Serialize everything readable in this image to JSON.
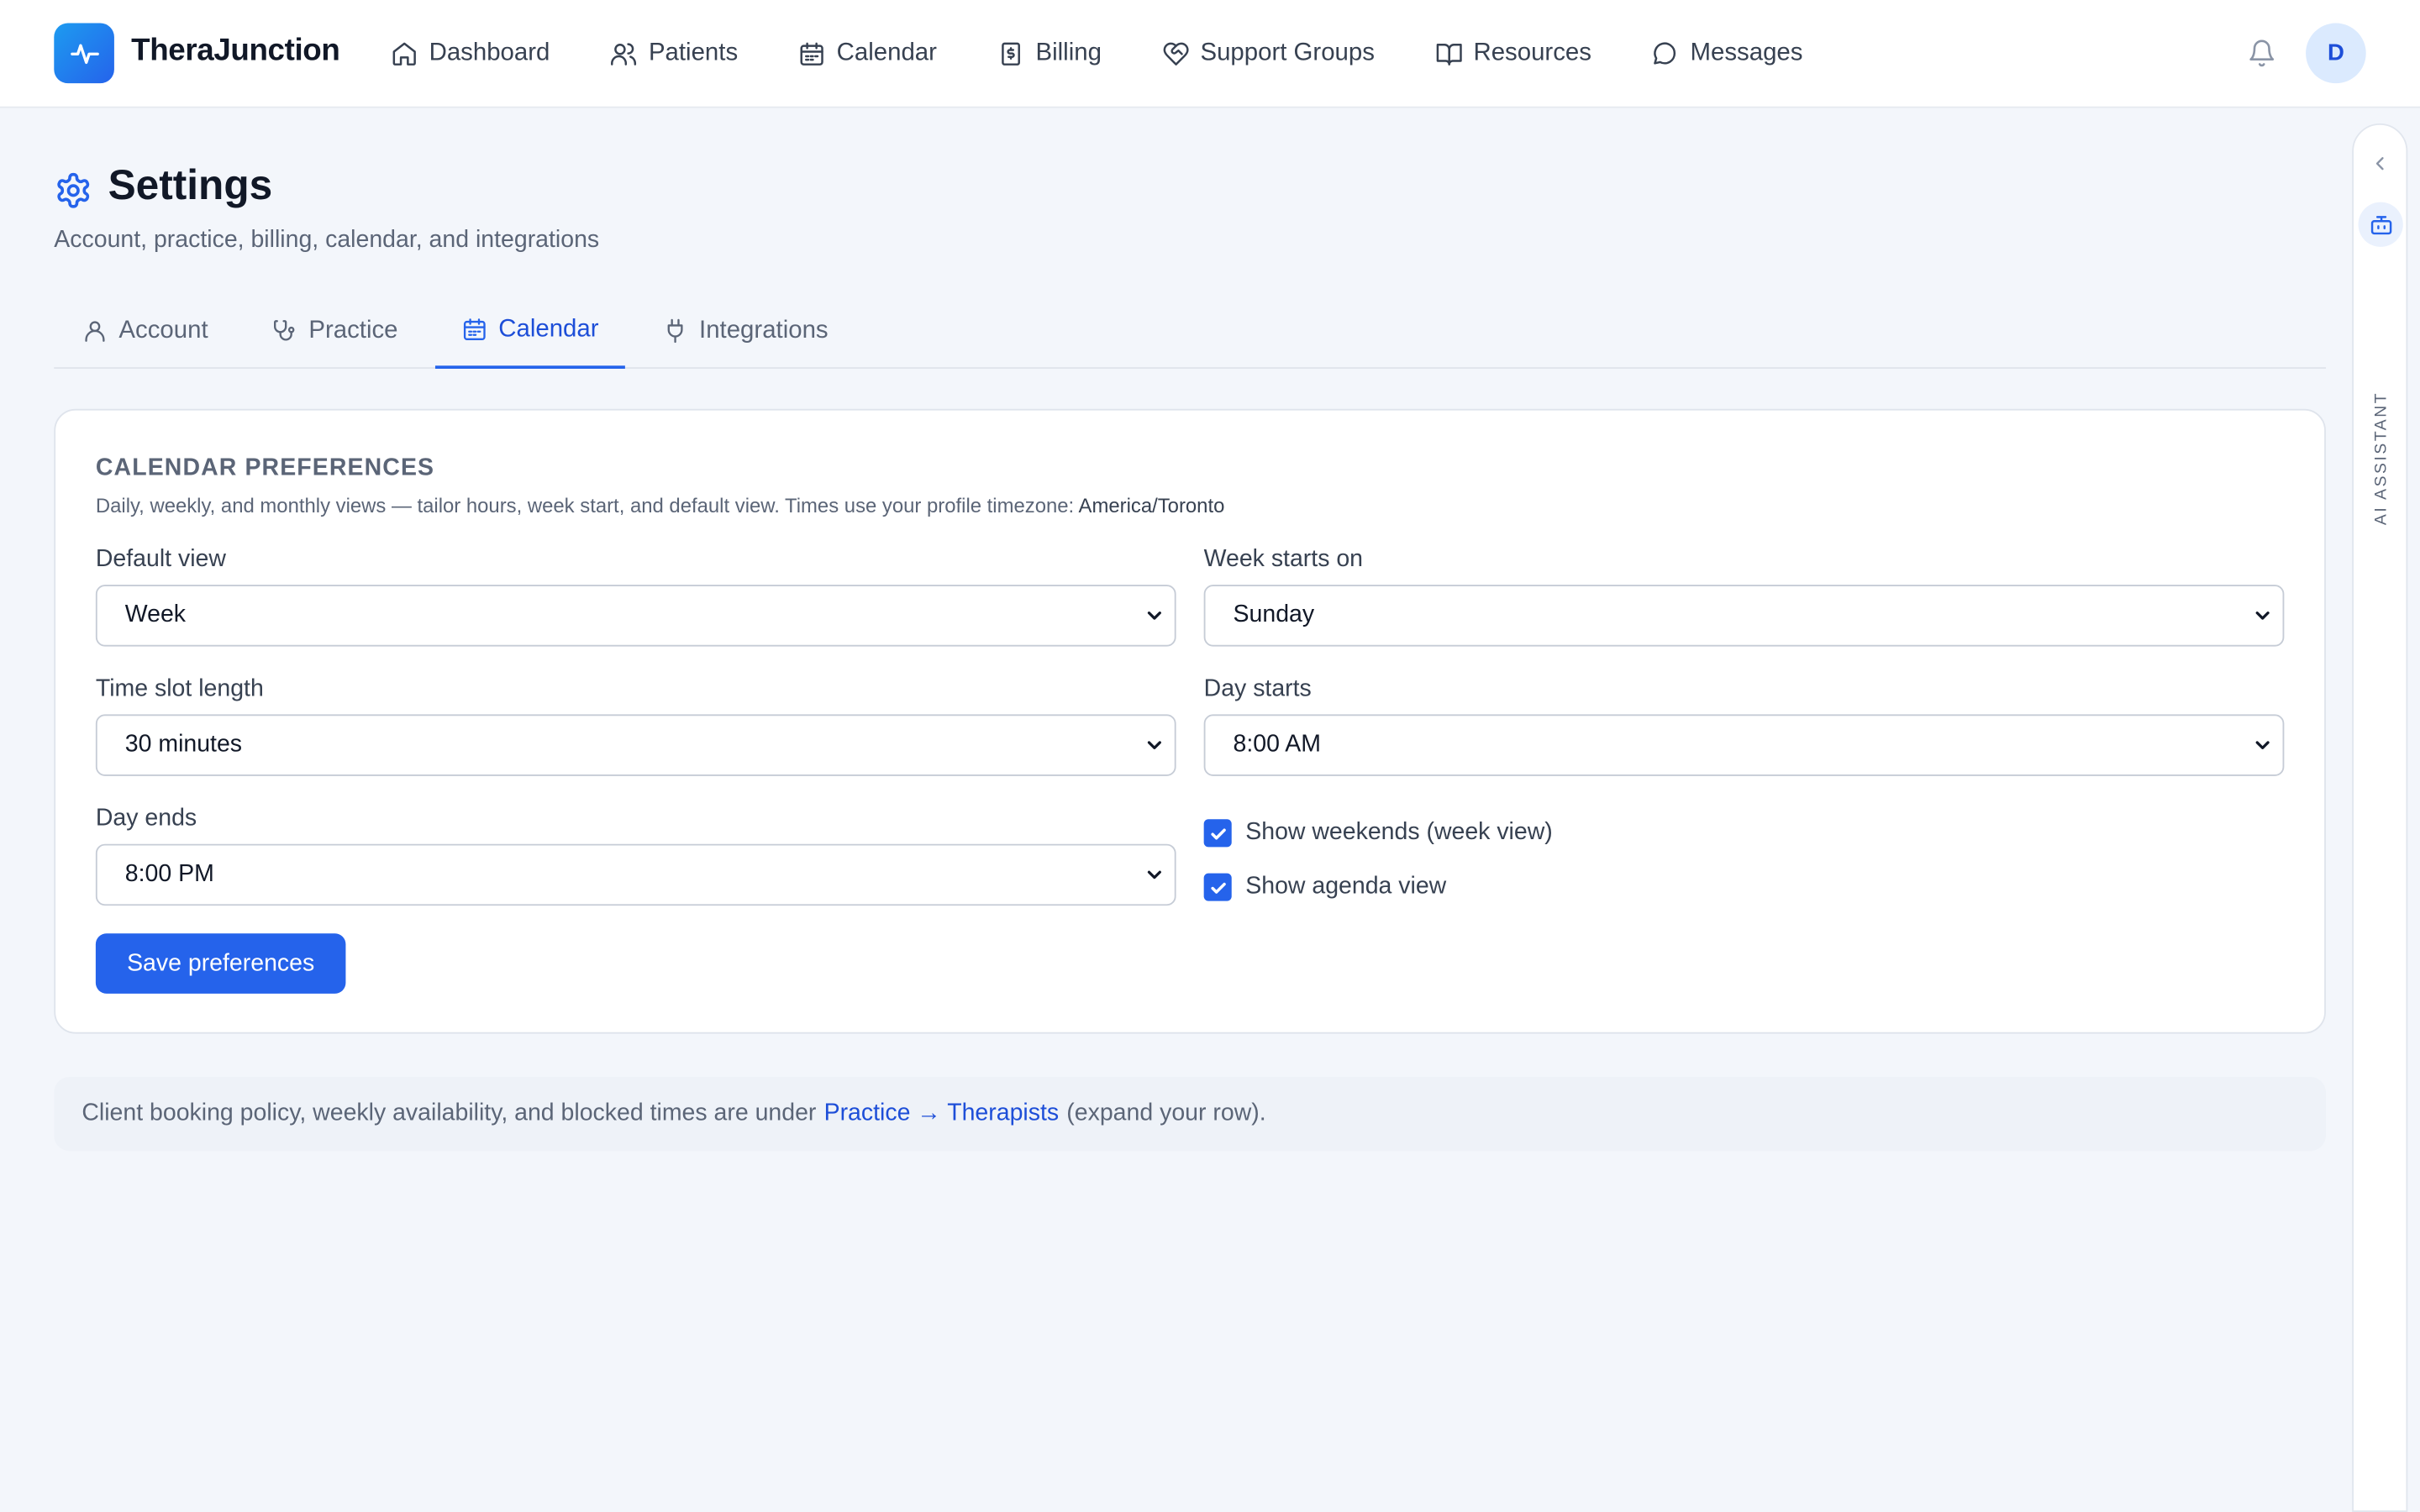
{
  "app": {
    "name": "TheraJunction",
    "avatar_initial": "D"
  },
  "nav": {
    "items": [
      {
        "label": "Dashboard",
        "icon": "home-icon"
      },
      {
        "label": "Patients",
        "icon": "users-icon"
      },
      {
        "label": "Calendar",
        "icon": "calendar-icon"
      },
      {
        "label": "Billing",
        "icon": "receipt-icon"
      },
      {
        "label": "Support Groups",
        "icon": "heart-handshake-icon"
      },
      {
        "label": "Resources",
        "icon": "book-icon"
      },
      {
        "label": "Messages",
        "icon": "message-icon"
      }
    ]
  },
  "page": {
    "title": "Settings",
    "subtitle": "Account, practice, billing, calendar, and integrations"
  },
  "tabs": [
    {
      "label": "Account",
      "icon": "user-icon",
      "active": false
    },
    {
      "label": "Practice",
      "icon": "stethoscope-icon",
      "active": false
    },
    {
      "label": "Calendar",
      "icon": "calendar-icon",
      "active": true
    },
    {
      "label": "Integrations",
      "icon": "plug-icon",
      "active": false
    }
  ],
  "card": {
    "title": "CALENDAR PREFERENCES",
    "description": "Daily, weekly, and monthly views — tailor hours, week start, and default view. Times use your profile timezone:",
    "timezone": "America/Toronto",
    "fields": {
      "default_view": {
        "label": "Default view",
        "value": "Week"
      },
      "week_starts_on": {
        "label": "Week starts on",
        "value": "Sunday"
      },
      "time_slot_length": {
        "label": "Time slot length",
        "value": "30 minutes"
      },
      "day_starts": {
        "label": "Day starts",
        "value": "8:00 AM"
      },
      "day_ends": {
        "label": "Day ends",
        "value": "8:00 PM"
      }
    },
    "checkboxes": {
      "show_weekends": {
        "label": "Show weekends (week view)",
        "checked": true
      },
      "show_agenda": {
        "label": "Show agenda view",
        "checked": true
      }
    },
    "save_label": "Save preferences"
  },
  "note": {
    "prefix": "Client booking policy, weekly availability, and blocked times are under",
    "link": "Practice → Therapists",
    "suffix": "(expand your row)."
  },
  "rail": {
    "label": "AI ASSISTANT"
  },
  "colors": {
    "accent": "#2563eb",
    "background": "#f3f6fb",
    "text_muted": "#5b6577"
  }
}
